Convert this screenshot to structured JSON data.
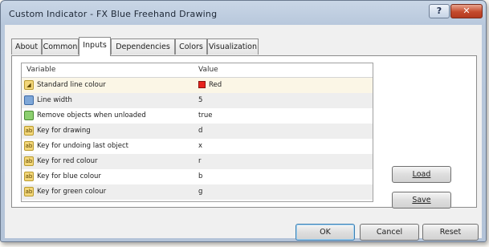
{
  "window": {
    "title": "Custom Indicator - FX Blue Freehand Drawing",
    "help_glyph": "?",
    "close_glyph": "✕"
  },
  "tabs": [
    {
      "label": "About",
      "active": false
    },
    {
      "label": "Common",
      "active": false
    },
    {
      "label": "Inputs",
      "active": true
    },
    {
      "label": "Dependencies",
      "active": false
    },
    {
      "label": "Colors",
      "active": false
    },
    {
      "label": "Visualization",
      "active": false
    }
  ],
  "grid": {
    "columns": {
      "variable": "Variable",
      "value": "Value"
    },
    "rows": [
      {
        "icon": "color-icon",
        "variable": "Standard line colour",
        "value": "Red",
        "swatch": "#e8231c"
      },
      {
        "icon": "number-icon",
        "variable": "Line width",
        "value": "5"
      },
      {
        "icon": "bool-icon",
        "variable": "Remove objects when unloaded",
        "value": "true"
      },
      {
        "icon": "string-icon",
        "variable": "Key for drawing",
        "value": "d"
      },
      {
        "icon": "string-icon",
        "variable": "Key for undoing last object",
        "value": "x"
      },
      {
        "icon": "string-icon",
        "variable": "Key for red colour",
        "value": "r"
      },
      {
        "icon": "string-icon",
        "variable": "Key for blue colour",
        "value": "b"
      },
      {
        "icon": "string-icon",
        "variable": "Key for green colour",
        "value": "g"
      }
    ],
    "scroll_up": "▲",
    "scroll_down": "▼"
  },
  "buttons": {
    "load": "Load",
    "save": "Save",
    "ok": "OK",
    "cancel": "Cancel",
    "reset": "Reset"
  },
  "colors": {
    "title_bar": "#b8c8dc",
    "close_button": "#c44a2c",
    "swatch_red": "#e8231c"
  }
}
